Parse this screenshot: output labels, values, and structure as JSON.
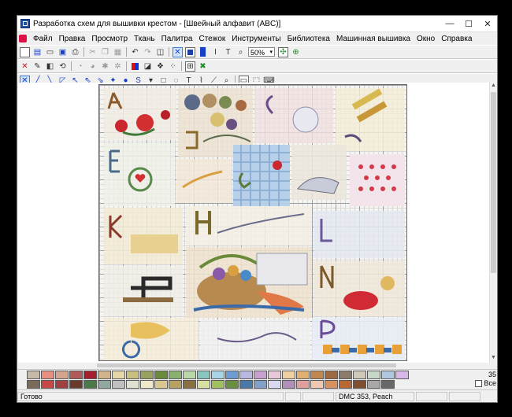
{
  "window": {
    "title": "Разработка схем для вышивки крестом - [Швейный алфавит (ABC)]",
    "min": "—",
    "max": "☐",
    "close": "✕"
  },
  "menu": [
    "Файл",
    "Правка",
    "Просмотр",
    "Ткань",
    "Палитра",
    "Стежок",
    "Инструменты",
    "Библиотека",
    "Машинная вышивка",
    "Окно",
    "Справка"
  ],
  "toolbar1": {
    "zoom_value": "50%",
    "zoom_arrow": "▾"
  },
  "toolbar_icons": {
    "row1": [
      "new-file-icon",
      "new-pattern-icon",
      "open-folder-icon",
      "save-icon",
      "print-icon",
      "cut-icon",
      "copy-icon",
      "paste-icon",
      "undo-icon",
      "redo-icon",
      "preview-icon",
      "full-cross-icon",
      "stop-square-icon",
      "backstitch-icon",
      "italic-icon",
      "text-icon",
      "zoom-out-icon",
      "zoom-in-icon",
      "fit-page-icon"
    ],
    "row2": [
      "clear-icon",
      "pencil-icon",
      "fill-icon",
      "rotate-icon",
      "rotate-back-icon",
      "mirror-icon",
      "magic-icon",
      "flip-icon",
      "color-square-icon",
      "color-pick-icon",
      "knot-icon",
      "bead-icon",
      "grid-icon",
      "cross-grid-icon"
    ],
    "row3": [
      "full-stitch-icon",
      "half-stitch-icon",
      "quarter-stitch-icon",
      "three-quarter-icon",
      "petite-icon",
      "arrow-tool-icon",
      "back-tool-icon",
      "french-knot-icon",
      "bead-tool-icon",
      "spiral-icon",
      "rectangle-icon",
      "lasso-icon",
      "text-tool-icon",
      "eyedropper-icon",
      "brush-icon",
      "search-icon",
      "ruler-icon",
      "select-icon",
      "symbol-icon"
    ]
  },
  "palette": {
    "row1": [
      "#c5b9a8",
      "#e98f80",
      "#d4a48c",
      "#b25959",
      "#a51e2e",
      "#d2b48c",
      "#e6d8a6",
      "#c8c080",
      "#9aa060",
      "#6a8a3c",
      "#88b06e",
      "#b8d8a8",
      "#8ac6c0",
      "#a8d4e8",
      "#6c9cd0",
      "#b8b8e0",
      "#c8a0d0",
      "#e8c8d8",
      "#f0d0a0",
      "#e0b070",
      "#c08850",
      "#a06a40",
      "#8c7a6a",
      "#d0c8b8",
      "#c8d8c8",
      "#b0c8e0",
      "#d8b8e8"
    ],
    "row2": [
      "#7a6a5a",
      "#c84848",
      "#a04040",
      "#6a3a2a",
      "#4a7a4a",
      "#90a8a0",
      "#c0c0c0",
      "#e0e0d0",
      "#f0e8c8",
      "#d8c890",
      "#b8a060",
      "#887040",
      "#d8e0a0",
      "#a0c060",
      "#689040",
      "#4878a8",
      "#80a0c8",
      "#d8d8f0",
      "#b090b8",
      "#e0a0a0",
      "#f0c8b0",
      "#d89060",
      "#b86830",
      "#805030",
      "#a8a8a8",
      "#686868"
    ],
    "count": "35",
    "all_label": "Все"
  },
  "status": {
    "ready": "Готово",
    "thread": "DMC  353, Peach"
  }
}
